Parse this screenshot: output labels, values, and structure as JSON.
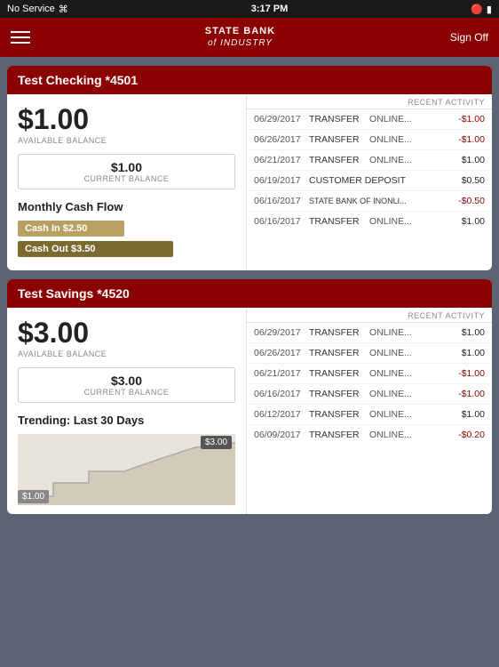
{
  "statusBar": {
    "left": "No Service",
    "wifi": "wifi",
    "time": "3:17 PM",
    "bluetooth": "bluetooth",
    "battery": "battery"
  },
  "header": {
    "menuIcon": "menu-icon",
    "logoLine1": "STATE BANK",
    "logoLine2": "of INDUSTRY",
    "signOff": "Sign Off"
  },
  "accounts": [
    {
      "id": "checking",
      "title": "Test Checking *4501",
      "availableBalance": "$1.00",
      "availableBalanceLabel": "AVAILABLE BALANCE",
      "currentBalance": "$1.00",
      "currentBalanceLabel": "CURRENT BALANCE",
      "leftSection": "cashflow",
      "cashFlowTitle": "Monthly Cash Flow",
      "cashIn": "Cash In $2.50",
      "cashOut": "Cash Out $3.50",
      "recentActivityLabel": "RECENT ACTIVITY",
      "transactions": [
        {
          "date": "06/29/2017",
          "type": "TRANSFER",
          "desc": "ONLINE...",
          "amount": "-$1.00",
          "negative": true
        },
        {
          "date": "06/26/2017",
          "type": "TRANSFER",
          "desc": "ONLINE...",
          "amount": "-$1.00",
          "negative": true
        },
        {
          "date": "06/21/2017",
          "type": "TRANSFER",
          "desc": "ONLINE...",
          "amount": "$1.00",
          "negative": false
        },
        {
          "date": "06/19/2017",
          "type": "CUSTOMER DEPOSIT",
          "desc": "",
          "amount": "$0.50",
          "negative": false
        },
        {
          "date": "06/16/2017",
          "type": "STATE BANK OF INONLI...",
          "desc": "",
          "amount": "-$0.50",
          "negative": true
        },
        {
          "date": "06/16/2017",
          "type": "TRANSFER",
          "desc": "ONLINE...",
          "amount": "$1.00",
          "negative": false
        }
      ]
    },
    {
      "id": "savings",
      "title": "Test Savings *4520",
      "availableBalance": "$3.00",
      "availableBalanceLabel": "AVAILABLE BALANCE",
      "currentBalance": "$3.00",
      "currentBalanceLabel": "CURRENT BALANCE",
      "leftSection": "trending",
      "trendingTitle": "Trending: Last 30 Days",
      "trendingLabelTop": "$3.00",
      "trendingLabelBottom": "$1.00",
      "recentActivityLabel": "RECENT ACTIVITY",
      "transactions": [
        {
          "date": "06/29/2017",
          "type": "TRANSFER",
          "desc": "ONLINE...",
          "amount": "$1.00",
          "negative": false
        },
        {
          "date": "06/26/2017",
          "type": "TRANSFER",
          "desc": "ONLINE...",
          "amount": "$1.00",
          "negative": false
        },
        {
          "date": "06/21/2017",
          "type": "TRANSFER",
          "desc": "ONLINE...",
          "amount": "-$1.00",
          "negative": true
        },
        {
          "date": "06/16/2017",
          "type": "TRANSFER",
          "desc": "ONLINE...",
          "amount": "-$1.00",
          "negative": true
        },
        {
          "date": "06/12/2017",
          "type": "TRANSFER",
          "desc": "ONLINE...",
          "amount": "$1.00",
          "negative": false
        },
        {
          "date": "06/09/2017",
          "type": "TRANSFER",
          "desc": "ONLINE...",
          "amount": "-$0.20",
          "negative": true
        }
      ]
    }
  ]
}
